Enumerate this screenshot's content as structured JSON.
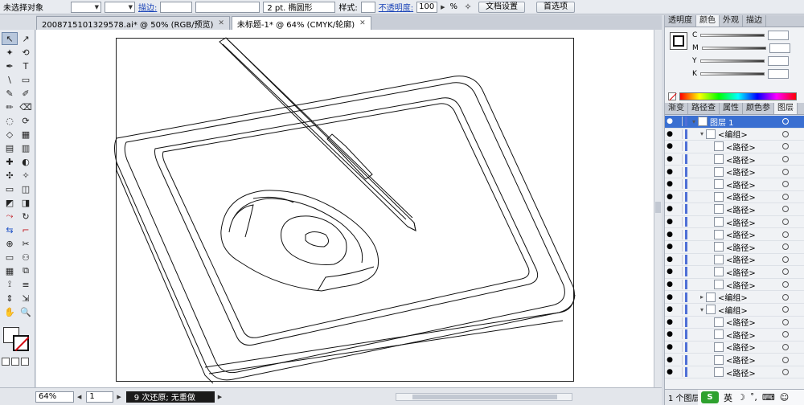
{
  "control_bar": {
    "selection_status": "未选择对象",
    "stroke_label": "描边:",
    "brush_value": "2 pt. 椭圆形",
    "style_label": "样式:",
    "opacity_label": "不透明度:",
    "opacity_value": "100",
    "opacity_unit": "%",
    "doc_setup_button": "文档设置",
    "preferences_button": "首选项"
  },
  "tabs": [
    {
      "label": "20087151013295​78.ai* @ 50% (RGB/预览)",
      "close": "✕"
    },
    {
      "label": "未标题-1* @ 64% (CMYK/轮廓)",
      "close": "✕"
    }
  ],
  "tools": [
    "↖",
    "↗",
    "✦",
    "⟲",
    "✒",
    "T",
    "\\",
    "▭",
    "✎",
    "✐",
    "✏",
    "⌫",
    "◌",
    "⟳",
    "◇",
    "▦",
    "▤",
    "▥",
    "✚",
    "◐",
    "✣",
    "✧",
    "▭",
    "◫",
    "◩",
    "◨",
    "⤳",
    "↻",
    "⇆",
    "⌐",
    "⊕",
    "✂",
    "▭",
    "⚇",
    "▦",
    "⧉",
    "⟟",
    "≡",
    "⇕",
    "⇲",
    "✋",
    "🔍"
  ],
  "panel_tabs_top": [
    "透明度",
    "颜色",
    "外观",
    "描边"
  ],
  "color_channels": [
    "C",
    "M",
    "Y",
    "K"
  ],
  "panel_tabs_bottom": [
    "渐变",
    "路径查",
    "属性",
    "颜色参",
    "图层"
  ],
  "layers": [
    {
      "label": "图层 1",
      "level": 0,
      "twirl": "▾",
      "type": "layer"
    },
    {
      "label": "<编组>",
      "level": 1,
      "twirl": "▾",
      "type": "group"
    },
    {
      "label": "<路径>",
      "level": 2,
      "twirl": "",
      "type": "path"
    },
    {
      "label": "<路径>",
      "level": 2,
      "twirl": "",
      "type": "path"
    },
    {
      "label": "<路径>",
      "level": 2,
      "twirl": "",
      "type": "path"
    },
    {
      "label": "<路径>",
      "level": 2,
      "twirl": "",
      "type": "path"
    },
    {
      "label": "<路径>",
      "level": 2,
      "twirl": "",
      "type": "path"
    },
    {
      "label": "<路径>",
      "level": 2,
      "twirl": "",
      "type": "path"
    },
    {
      "label": "<路径>",
      "level": 2,
      "twirl": "",
      "type": "path"
    },
    {
      "label": "<路径>",
      "level": 2,
      "twirl": "",
      "type": "path"
    },
    {
      "label": "<路径>",
      "level": 2,
      "twirl": "",
      "type": "path"
    },
    {
      "label": "<路径>",
      "level": 2,
      "twirl": "",
      "type": "path"
    },
    {
      "label": "<路径>",
      "level": 2,
      "twirl": "",
      "type": "path"
    },
    {
      "label": "<路径>",
      "level": 2,
      "twirl": "",
      "type": "path"
    },
    {
      "label": "<编组>",
      "level": 1,
      "twirl": "▸",
      "type": "group"
    },
    {
      "label": "<编组>",
      "level": 1,
      "twirl": "▾",
      "type": "group"
    },
    {
      "label": "<路径>",
      "level": 2,
      "twirl": "",
      "type": "path"
    },
    {
      "label": "<路径>",
      "level": 2,
      "twirl": "",
      "type": "path"
    },
    {
      "label": "<路径>",
      "level": 2,
      "twirl": "",
      "type": "path"
    },
    {
      "label": "<路径>",
      "level": 2,
      "twirl": "",
      "type": "path"
    },
    {
      "label": "<路径>",
      "level": 2,
      "twirl": "",
      "type": "path"
    }
  ],
  "layers_footer": "1 个图层",
  "status": {
    "zoom": "64%",
    "page": "1",
    "history": "9 次还原; 无重做"
  },
  "ime": {
    "logo": "S",
    "mode": "英"
  },
  "colors": {
    "accent": "#3a6fd1",
    "stroke_none": "#d40a14"
  }
}
